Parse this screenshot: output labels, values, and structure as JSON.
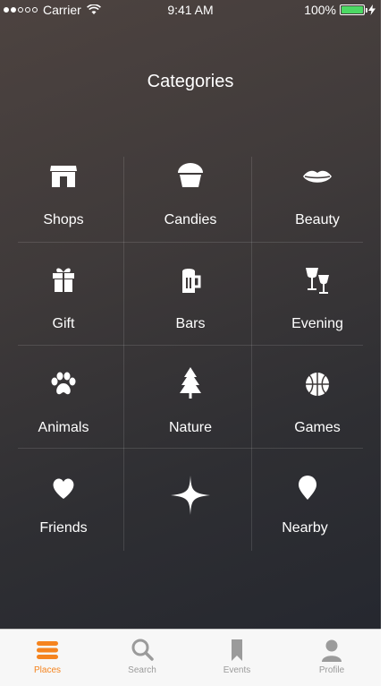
{
  "status_bar": {
    "carrier": "Carrier",
    "time": "9:41 AM",
    "battery": "100%",
    "battery_level": 1.0,
    "signal_bars_filled": 2,
    "signal_bars_total": 5
  },
  "page": {
    "title": "Categories"
  },
  "categories": [
    {
      "label": "Shops",
      "icon": "shop-icon"
    },
    {
      "label": "Candies",
      "icon": "cupcake-icon"
    },
    {
      "label": "Beauty",
      "icon": "lips-icon"
    },
    {
      "label": "Gift",
      "icon": "gift-icon"
    },
    {
      "label": "Bars",
      "icon": "beer-mug-icon"
    },
    {
      "label": "Evening",
      "icon": "wine-glasses-icon"
    },
    {
      "label": "Animals",
      "icon": "paw-icon"
    },
    {
      "label": "Nature",
      "icon": "tree-icon"
    },
    {
      "label": "Games",
      "icon": "basketball-icon"
    },
    {
      "label": "Friends",
      "icon": "heart-icon"
    },
    {
      "label": "",
      "icon": "add-sparkle-icon"
    },
    {
      "label": "Nearby",
      "icon": "location-pin-icon"
    }
  ],
  "tab_bar": {
    "tabs": [
      {
        "label": "Places",
        "icon": "menu-icon",
        "active": true
      },
      {
        "label": "Search",
        "icon": "search-icon",
        "active": false
      },
      {
        "label": "Events",
        "icon": "bookmark-icon",
        "active": false
      },
      {
        "label": "Profile",
        "icon": "person-icon",
        "active": false
      }
    ]
  },
  "colors": {
    "accent": "#f5841f",
    "inactive_tab": "#9b9b9b",
    "battery_fill": "#4cd964",
    "background_top": "#4d4340",
    "background_bottom": "#23262e"
  }
}
